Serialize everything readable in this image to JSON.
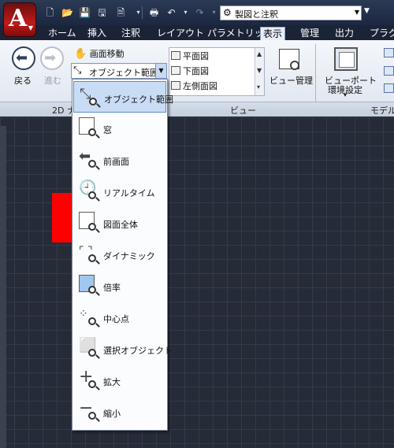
{
  "workspace": {
    "name": "製図と注釈"
  },
  "tabs": [
    "ホーム",
    "挿入",
    "注釈",
    "レイアウト",
    "パラメトリック",
    "表示",
    "管理",
    "出力",
    "プラグイ"
  ],
  "active_tab": "表示",
  "ribbon": {
    "back_label": "戻る",
    "forward_label": "進む",
    "pan_label": "画面移動",
    "extents_label": "オブジェクト範囲",
    "views": [
      "平面図",
      "下面図",
      "左側面図"
    ],
    "view_manager_label": "ビュー管理",
    "viewport_label_1": "ビューポート",
    "viewport_label_2": "環境設定",
    "panel_2d": "2D ナ",
    "panel_view": "ビュー",
    "panel_model": "モデル"
  },
  "zoom_menu": {
    "items": [
      {
        "label": "オブジェクト範囲",
        "icon": "zoom-object-icon"
      },
      {
        "label": "窓",
        "icon": "zoom-window-icon"
      },
      {
        "label": "前画面",
        "icon": "zoom-previous-icon"
      },
      {
        "label": "リアルタイム",
        "icon": "zoom-realtime-icon"
      },
      {
        "label": "図面全体",
        "icon": "zoom-all-icon"
      },
      {
        "label": "ダイナミック",
        "icon": "zoom-dynamic-icon"
      },
      {
        "label": "倍率",
        "icon": "zoom-scale-icon"
      },
      {
        "label": "中心点",
        "icon": "zoom-center-icon"
      },
      {
        "label": "選択オブジェクト",
        "icon": "zoom-selected-icon"
      },
      {
        "label": "拡大",
        "icon": "zoom-in-icon"
      },
      {
        "label": "縮小",
        "icon": "zoom-out-icon"
      }
    ],
    "selected_index": 0
  },
  "colors": {
    "accent_red": "#ff0000",
    "canvas_bg": "#262b38",
    "menu_highlight": "#c9dcf5"
  }
}
